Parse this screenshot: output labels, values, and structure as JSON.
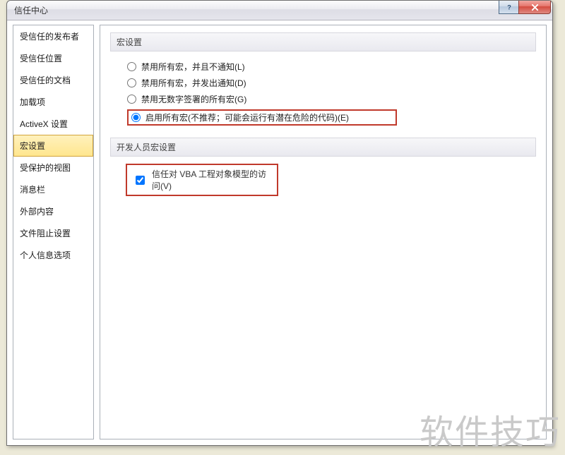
{
  "window": {
    "title": "信任中心"
  },
  "sidebar": {
    "items": [
      {
        "label": "受信任的发布者"
      },
      {
        "label": "受信任位置"
      },
      {
        "label": "受信任的文档"
      },
      {
        "label": "加载项"
      },
      {
        "label": "ActiveX 设置"
      },
      {
        "label": "宏设置",
        "selected": true
      },
      {
        "label": "受保护的视图"
      },
      {
        "label": "消息栏"
      },
      {
        "label": "外部内容"
      },
      {
        "label": "文件阻止设置"
      },
      {
        "label": "个人信息选项"
      }
    ]
  },
  "section1": {
    "header": "宏设置",
    "options": [
      {
        "label": "禁用所有宏，并且不通知(L)"
      },
      {
        "label": "禁用所有宏，并发出通知(D)"
      },
      {
        "label": "禁用无数字签署的所有宏(G)"
      },
      {
        "label": "启用所有宏(不推荐；可能会运行有潜在危险的代码)(E)",
        "highlighted": true
      }
    ],
    "selected": 3
  },
  "section2": {
    "header": "开发人员宏设置",
    "checkbox": {
      "label": "信任对 VBA 工程对象模型的访问(V)",
      "checked": true,
      "highlighted": true
    }
  },
  "watermark": "软件技巧"
}
